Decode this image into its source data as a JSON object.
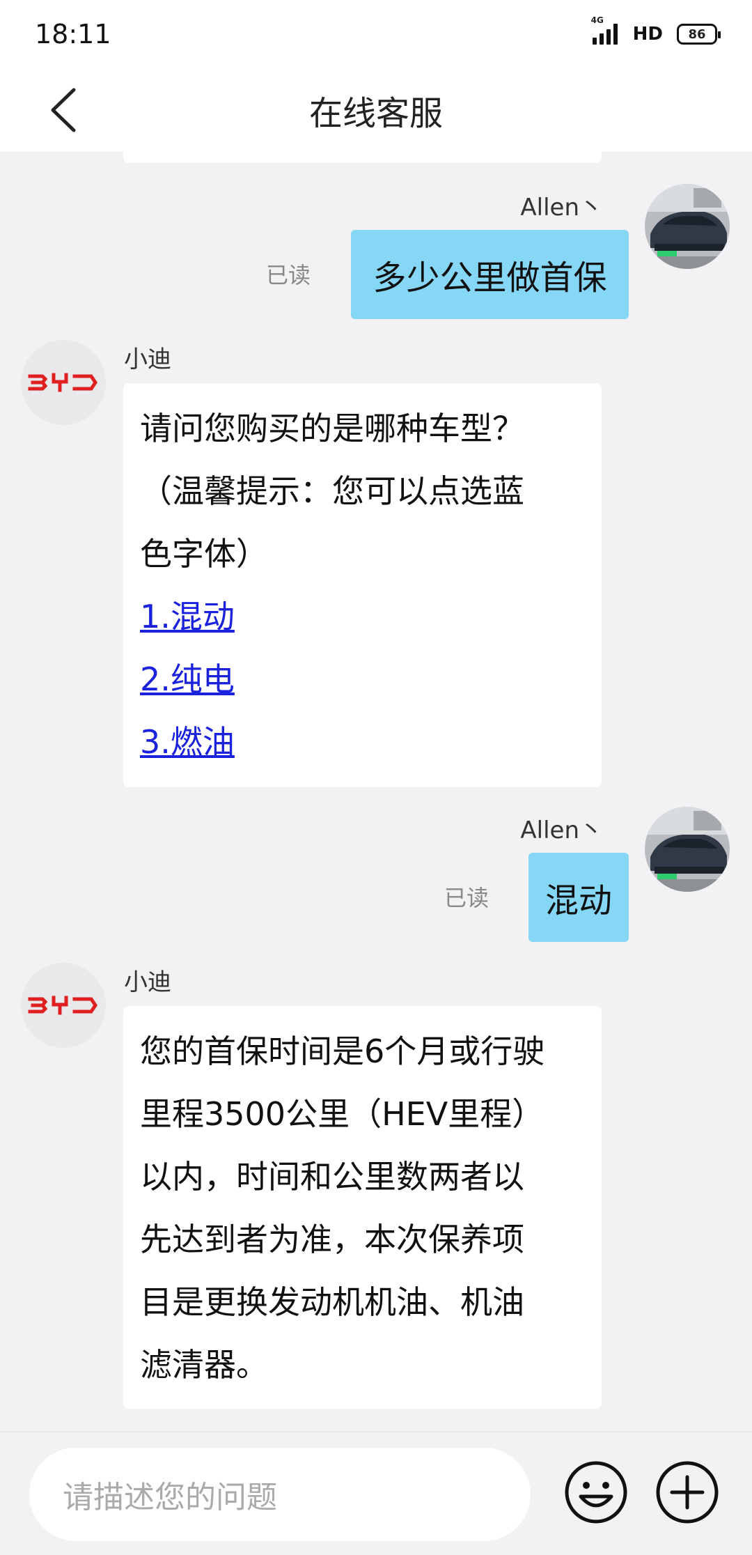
{
  "status": {
    "time": "18:11",
    "network": "4G",
    "hd": "HD",
    "battery": "86"
  },
  "nav": {
    "title": "在线客服"
  },
  "messages": [
    {
      "sender": "Allen丶",
      "text": "多少公里做首保",
      "read": "已读"
    },
    {
      "sender": "小迪",
      "lines": [
        "请问您购买的是哪种车型？",
        "（温馨提示：您可以点选蓝",
        "色字体）"
      ],
      "links": [
        "1.混动",
        "2.纯电",
        "3.燃油"
      ]
    },
    {
      "sender": "Allen丶",
      "text": "混动",
      "read": "已读"
    },
    {
      "sender": "小迪",
      "lines": [
        "您的首保时间是6个月或行驶",
        "里程3500公里（HEV里程）",
        "以内，时间和公里数两者以",
        "先达到者为准，本次保养项",
        "目是更换发动机机油、机油",
        "滤清器。"
      ]
    }
  ],
  "input": {
    "placeholder": "请描述您的问题"
  },
  "colors": {
    "user_bubble": "#86d6f6",
    "link": "#1a22dd",
    "brand_red": "#e02020"
  },
  "icons": [
    "back-arrow-icon",
    "car-avatar",
    "byd-logo-icon",
    "emoji-icon",
    "plus-icon"
  ]
}
